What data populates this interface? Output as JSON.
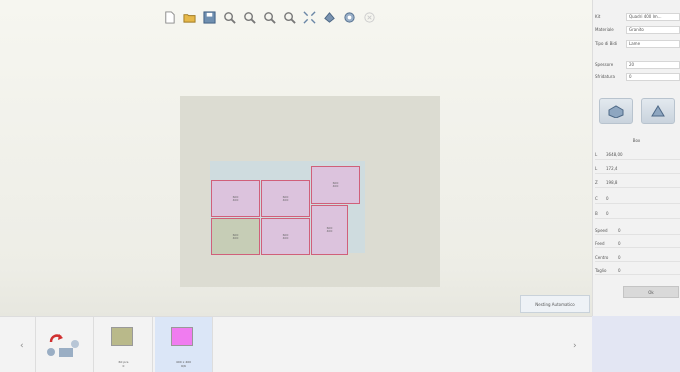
{
  "toolbar": {
    "icons": [
      "new-file-icon",
      "open-folder-icon",
      "save-icon",
      "zoom-in-icon",
      "zoom-out-icon",
      "zoom-fit-icon",
      "zoom-selection-icon",
      "expand-icon",
      "paint-icon",
      "settings-icon",
      "close-icon"
    ]
  },
  "canvas": {
    "pieces": [
      {
        "label": "600\n400"
      },
      {
        "label": "600\n400"
      },
      {
        "label": "600\n400"
      },
      {
        "label": "600\n400"
      },
      {
        "label": "600\n400"
      },
      {
        "label": "600\n400"
      }
    ],
    "nesting_button": "Nesting Automatico"
  },
  "panel": {
    "fields": [
      {
        "label": "Kit",
        "value": "Quadri 400 Im..."
      },
      {
        "label": "Materiale",
        "value": "Granito"
      },
      {
        "label": "Tipo di Bidi",
        "value": "Lame"
      },
      {
        "label": "Spessore",
        "value": "20"
      },
      {
        "label": "Sfridatura",
        "value": "0"
      }
    ],
    "box_header": "Box",
    "box_rows": [
      {
        "label": "L",
        "value": "3648,00"
      },
      {
        "label": "L",
        "value": "172,4"
      },
      {
        "label": "Z",
        "value": "198,8"
      },
      {
        "label": "C",
        "value": "0"
      },
      {
        "label": "B",
        "value": "0"
      }
    ],
    "speed_rows": [
      {
        "label": "Speed",
        "value": "0"
      },
      {
        "label": "Feed",
        "value": "0"
      },
      {
        "label": "Centro",
        "value": "0"
      },
      {
        "label": "Taglio",
        "value": "0"
      }
    ],
    "ok_label": "Ok"
  },
  "strip": {
    "thumbs": [
      {
        "label": "",
        "color": ""
      },
      {
        "label": "60 pcs\n0",
        "color": "#b9b98a"
      },
      {
        "label": "400 x 400\n6/6",
        "color": "#f07cf0"
      }
    ]
  },
  "colors": {
    "piece": "#dcc3dd",
    "piece_green": "#c6cdb6",
    "sheet": "#cfdcdf",
    "board": "#dcdcd2"
  }
}
